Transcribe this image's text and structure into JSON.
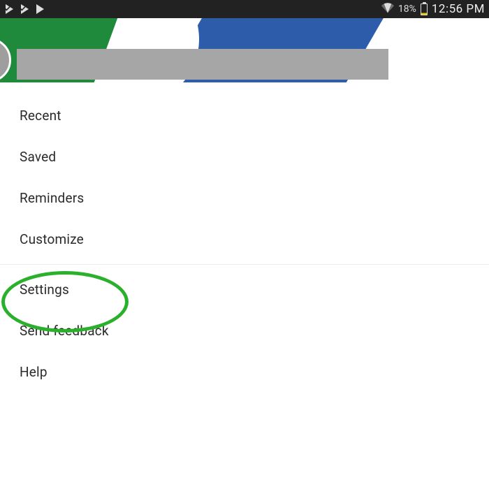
{
  "status_bar": {
    "battery_percent": "18%",
    "battery_level_color": "#f0c400",
    "clock": "12:56 PM"
  },
  "header": {
    "search_placeholder": ""
  },
  "menu": {
    "group1": [
      {
        "label": "Recent"
      },
      {
        "label": "Saved"
      },
      {
        "label": "Reminders"
      },
      {
        "label": "Customize"
      }
    ],
    "group2": [
      {
        "label": "Settings"
      },
      {
        "label": "Send feedback"
      },
      {
        "label": "Help"
      }
    ]
  },
  "annotation": {
    "highlighted_item": "Settings",
    "highlight_color": "#2bb02b"
  }
}
